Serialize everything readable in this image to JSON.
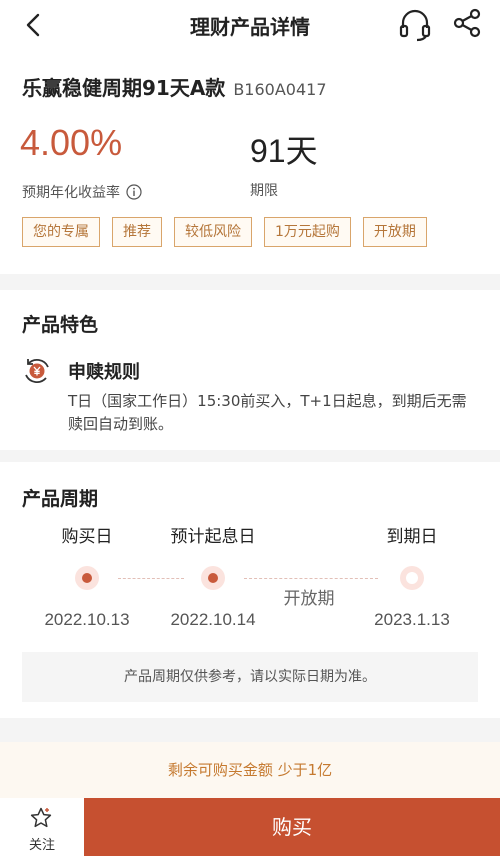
{
  "nav": {
    "title": "理财产品详情",
    "back_icon": "chevron-left-icon",
    "service_icon": "headset-icon",
    "share_icon": "share-icon"
  },
  "product": {
    "name": "乐赢稳健周期91天A款",
    "code": "B160A0417",
    "rate": "4.00%",
    "rate_label": "预期年化收益率",
    "term": "91天",
    "term_label": "期限",
    "tags": [
      "您的专属",
      "推荐",
      "较低风险",
      "1万元起购",
      "开放期"
    ]
  },
  "features": {
    "title": "产品特色",
    "items": [
      {
        "icon": "yen-cycle-icon",
        "name": "申赎规则",
        "desc": "T日（国家工作日）15:30前买入，T+1日起息，到期后无需赎回自动到账。"
      }
    ]
  },
  "cycle": {
    "title": "产品周期",
    "steps": [
      {
        "label": "购买日",
        "date": "2022.10.13"
      },
      {
        "label": "预计起息日",
        "date": "2022.10.14"
      },
      {
        "label": "到期日",
        "date": "2023.1.13"
      }
    ],
    "open_label": "开放期",
    "note": "产品周期仅供参考，请以实际日期为准。"
  },
  "remaining": {
    "text": "剩余可购买金额  少于1亿"
  },
  "bottom": {
    "fav_label": "关注",
    "buy_label": "购买"
  },
  "colors": {
    "accent": "#c85a3c",
    "buy_button": "#c65030",
    "tag_border": "#d9a56b"
  }
}
